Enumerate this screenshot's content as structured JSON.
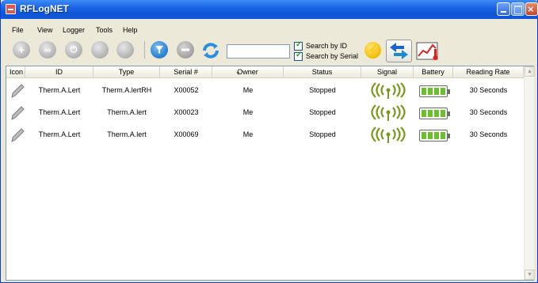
{
  "window": {
    "title": "RFLogNET"
  },
  "menu": {
    "items": [
      "File",
      "View",
      "Logger",
      "Tools",
      "Help"
    ]
  },
  "toolbar": {
    "add_icon": "plus-circle-icon",
    "link_icon": "link-circle-icon",
    "power_icon": "power-circle-icon",
    "search_value": "",
    "search_by_id_label": "Search by ID",
    "search_by_id_checked": true,
    "search_by_serial_label": "Search by Serial",
    "search_by_serial_checked": true
  },
  "table": {
    "columns": [
      "Icon",
      "ID",
      "Type",
      "Serial #",
      "Owner",
      "Status",
      "Signal",
      "Battery",
      "Reading Rate"
    ],
    "rows": [
      {
        "id": "Therm.A.Lert",
        "type": "Therm.A.lertRH",
        "serial": "X00052",
        "owner": "Me",
        "status": "Stopped",
        "signal_icon": "signal-strength-icon",
        "battery_level": 1.0,
        "reading_rate": "30 Seconds"
      },
      {
        "id": "Therm.A.Lert",
        "type": "Therm.A.lert",
        "serial": "X00023",
        "owner": "Me",
        "status": "Stopped",
        "signal_icon": "signal-strength-icon",
        "battery_level": 1.0,
        "reading_rate": "30 Seconds"
      },
      {
        "id": "Therm.A.Lert",
        "type": "Therm.A.lert",
        "serial": "X00069",
        "owner": "Me",
        "status": "Stopped",
        "signal_icon": "signal-strength-icon",
        "battery_level": 1.0,
        "reading_rate": "30 Seconds"
      }
    ]
  },
  "colors": {
    "title_bar": "#0d55da",
    "signal": "#7a9a1c",
    "battery_fill": "#6bbf2d",
    "filter_button": "#2e86d6",
    "lightning": "#f4c40e"
  }
}
